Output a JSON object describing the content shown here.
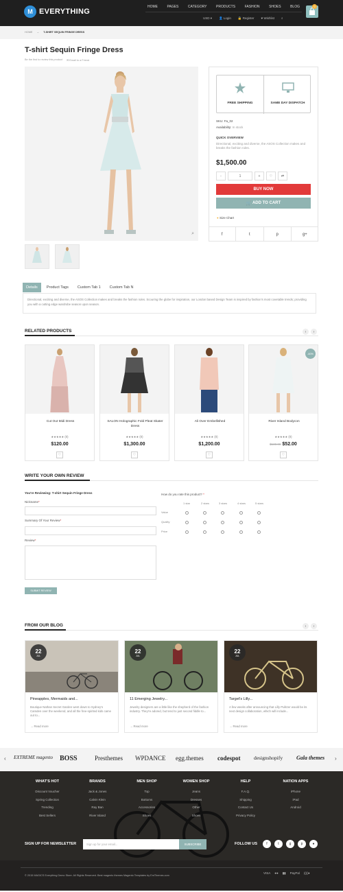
{
  "header": {
    "logo_letter": "M",
    "logo": "EVERYTHING",
    "nav": [
      "HOME",
      "PAGES",
      "CATEGORY",
      "PRODUCTS",
      "FASHION",
      "SHOES",
      "BLOG"
    ],
    "util": [
      "USD ▾",
      "Login",
      "Register",
      "Wishlist"
    ],
    "cart_count": "0",
    "icons": [
      "user-icon",
      "lock-icon",
      "heart-icon",
      "search-icon",
      "bag-icon"
    ]
  },
  "breadcrumb": {
    "home": "HOME",
    "sep": "→",
    "current": "T-SHIRT SEQUIN FRINGE DRESS"
  },
  "product": {
    "title": "T-shirt Sequin Fringe Dress",
    "reviews_link": "Be the first to review this product",
    "email_link": "Email to a Friend",
    "free_shipping": "FREE SHIPPING",
    "same_day": "SAME DAY DISPATCH",
    "sku": "SKU: Fa_02",
    "availability_label": "Availability:",
    "availability": "In stock",
    "overview_title": "QUICK OVERVIEW",
    "overview": "Directional, exciting and diverse, the ASOS Collection makes and breaks the fashion rules.",
    "price": "$1,500.00",
    "qty": "1",
    "buy_now": "BUY NOW",
    "add_to_cart": "ADD TO CART",
    "size_chart": "Size Chart",
    "share": [
      "f",
      "t",
      "p",
      "g+"
    ]
  },
  "tabs": {
    "items": [
      "Details",
      "Product Tags",
      "Custom Tab 1",
      "Custom Tab N"
    ],
    "active": 0,
    "body": "Directional, exciting and diverse, the ASOS Collection makes and breaks the fashion rules. Scouring the globe for inspiration, our London based Design Team is inspired by fashion's most covetable trends; providing you with a cutting edge wardrobe season upon season."
  },
  "related": {
    "title": "RELATED PRODUCTS",
    "sale_badge": "-60%",
    "items": [
      {
        "name": "Cut Out Midi Dress",
        "stars": "★★★★★ (0)",
        "price": "$120.00",
        "old": ""
      },
      {
        "name": "SALON Holographic Fold Pleat Skater Dress",
        "stars": "★★★★★ (0)",
        "price": "$1,300.00",
        "old": ""
      },
      {
        "name": "Ali Over Embellished",
        "stars": "★★★★★ (0)",
        "price": "$1,200.00",
        "old": ""
      },
      {
        "name": "River Island Bodycon",
        "stars": "★★★★★ (0)",
        "price": "$52.00",
        "old": "$130.00"
      }
    ]
  },
  "review": {
    "title": "WRITE YOUR OWN REVIEW",
    "reviewing": "You're Reviewing: T-shirt Sequin Fringe Dress",
    "nickname": "Nickname",
    "summary": "Summary Of Your Review",
    "review": "Review",
    "req": "*",
    "submit": "SUBMIT REVIEW",
    "rate_q": "How do you rate this product?",
    "cols": [
      "1 star",
      "2 stars",
      "3 stars",
      "4 stars",
      "5 stars"
    ],
    "rows": [
      "Value",
      "Quality",
      "Price"
    ]
  },
  "blog": {
    "title": "FROM OUR BLOG",
    "posts": [
      {
        "day": "22",
        "month": "JUL",
        "title": "Pineapples, Mermaids and...",
        "excerpt": "Boutique Nathan Secret Garden went down to Sydney's Camden over the weekend, and all the free-spirited kids came out to...",
        "more": "→ Read more"
      },
      {
        "day": "22",
        "month": "JUL",
        "title": "11 Emerging Jewelry...",
        "excerpt": "Jewelry designers are a little like the shepherd of the fashion industry. They're adored, but tend to just second fiddle to...",
        "more": "→ Read more"
      },
      {
        "day": "22",
        "month": "JUL",
        "title": "Target's Lilly...",
        "excerpt": "A few weeks after announcing that Lilly Pulitzer would be its next design collaboration, which will include...",
        "more": "→ Read more"
      }
    ]
  },
  "brands": [
    "EXTREME magento",
    "BOSS",
    "Presthemes",
    "WPDANCE",
    "egg.themes",
    "codespot",
    "designshopify",
    "Gala themes"
  ],
  "footer": {
    "cols": [
      {
        "h": "WHAT'S HOT",
        "items": [
          "Discount Voucher",
          "Spring Collection",
          "Trending",
          "Best Sellers"
        ]
      },
      {
        "h": "BRANDS",
        "items": [
          "Jack & Jones",
          "Calvin Klein",
          "Ray Ban",
          "River Island"
        ]
      },
      {
        "h": "MEN SHOP",
        "items": [
          "Top",
          "Bottoms",
          "Accessories",
          "Shoes"
        ]
      },
      {
        "h": "WOMEN SHOP",
        "items": [
          "Jeans",
          "Dresses",
          "Other",
          "Shoes"
        ]
      },
      {
        "h": "HELP",
        "items": [
          "F.A.Q.",
          "Shipping",
          "Contact Us",
          "Privacy Policy"
        ]
      },
      {
        "h": "NATION APPS",
        "items": [
          "iPhone",
          "iPad",
          "Android"
        ]
      }
    ],
    "newsletter": "SIGN UP FOR NEWSLETTER",
    "nl_placeholder": "Sign up for your email...",
    "subscribe": "SUBSCRIBE",
    "follow": "FOLLOW US",
    "socials": [
      "f",
      "t",
      "g",
      "p",
      "●"
    ],
    "copyright": "© 2015 MAGICS Everything Demo Store. All Rights Reserved. Best magento themes Magento Templates by EmThemes.com",
    "payments": [
      "VISA",
      "●●",
      "▮▮",
      "PayPal",
      "((((●"
    ]
  },
  "colors": {
    "accent": "#90b4b2",
    "buy": "#e23a3a",
    "header": "#1f1f1f",
    "footer": "#2b2926",
    "badge": "#f3b33d"
  }
}
